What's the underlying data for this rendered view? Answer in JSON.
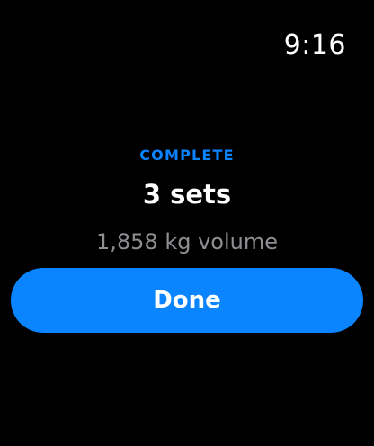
{
  "status_bar": {
    "time": "9:16"
  },
  "summary": {
    "status_label": "COMPLETE",
    "sets_text": "3 sets",
    "volume_text": "1,858 kg volume"
  },
  "actions": {
    "done_label": "Done"
  },
  "colors": {
    "background": "#000000",
    "accent": "#0a84ff",
    "secondary_text": "#8e8e93",
    "primary_text": "#ffffff"
  }
}
